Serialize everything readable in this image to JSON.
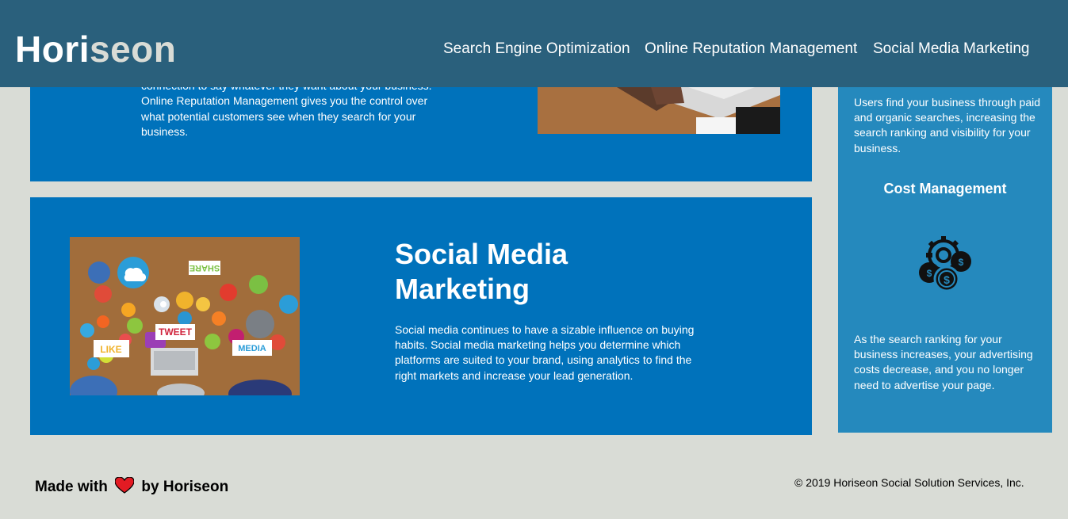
{
  "header": {
    "logo_primary": "Hori",
    "logo_accent": "seon",
    "nav": [
      {
        "label": "Search Engine Optimization"
      },
      {
        "label": "Online Reputation Management"
      },
      {
        "label": "Social Media Marketing"
      }
    ]
  },
  "content": {
    "online_reputation": {
      "text": "negative. Social media allows anyone with an internet connection to say whatever they want about your business. Online Reputation Management gives you the control over what potential customers see when they search for your business."
    },
    "social_media": {
      "title": "Social Media Marketing",
      "text": "Social media continues to have a sizable influence on buying habits. Social media marketing helps you determine which platforms are suited to your brand, using analytics to find the right markets and increase your lead generation.",
      "image_badges": [
        "SHARE",
        "TWEET",
        "LIKE",
        "MEDIA"
      ]
    }
  },
  "sidebar": {
    "lead_text": "Users find your business through paid and organic searches, increasing the search ranking and visibility for your business.",
    "cost_heading": "Cost Management",
    "cost_icon": "cost-management-icon",
    "cost_text": "As the search ranking for your business increases, your advertising costs decrease, and you no longer need to advertise your page."
  },
  "footer": {
    "made_prefix": "Made with",
    "made_suffix": "by Horiseon",
    "copyright": "© 2019 Horiseon Social Solution Services, Inc."
  },
  "colors": {
    "header_bg": "#2a607c",
    "page_bg": "#d9dcd6",
    "card_bg": "#0072bb",
    "sidebar_bg": "#2589bd",
    "heart": "#e31b23"
  }
}
